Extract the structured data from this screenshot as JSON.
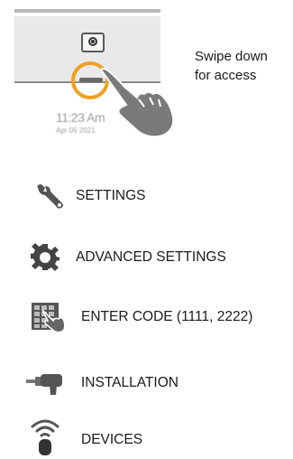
{
  "hint": {
    "line1": "Swipe down",
    "line2": "for access"
  },
  "panel": {
    "time": "11:23 Am",
    "date": "Apr 05 2021",
    "accent_color": "#f0a020"
  },
  "menu": {
    "items": [
      {
        "label": "SETTINGS",
        "icon": "wrench-icon"
      },
      {
        "label": "ADVANCED SETTINGS",
        "icon": "gear-icon"
      },
      {
        "label": "ENTER CODE (1111, 2222)",
        "icon": "keypad-hand-icon"
      },
      {
        "label": "INSTALLATION",
        "icon": "drill-icon"
      },
      {
        "label": "DEVICES",
        "icon": "wireless-sensor-icon"
      }
    ]
  }
}
